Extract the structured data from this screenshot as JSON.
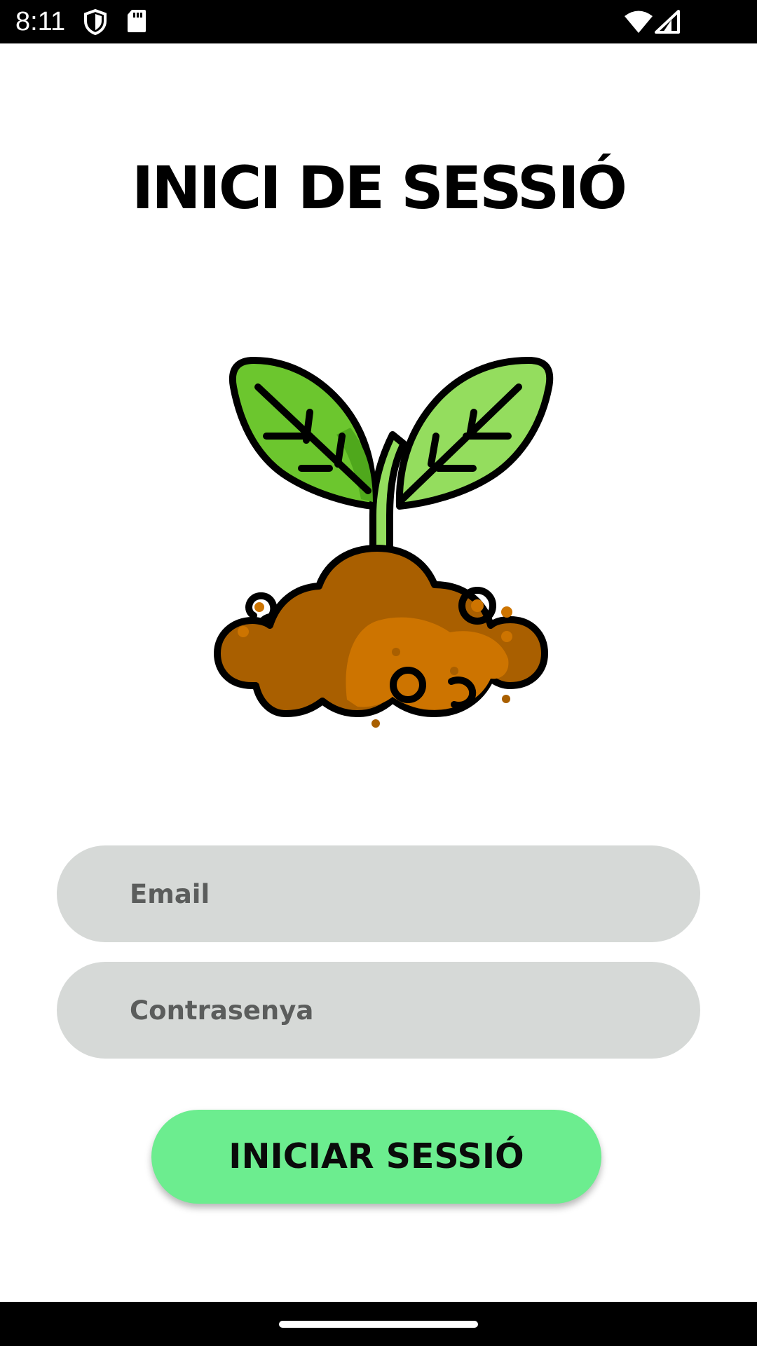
{
  "status_bar": {
    "time": "8:11",
    "left_icons": [
      "shield-icon",
      "sd-card-icon"
    ],
    "right_icons": [
      "wifi-icon",
      "signal-icon"
    ]
  },
  "login": {
    "title": "INICI DE SESSIÓ",
    "illustration": "sprout-in-soil-icon",
    "email": {
      "placeholder": "Email",
      "value": ""
    },
    "password": {
      "placeholder": "Contrasenya",
      "value": ""
    },
    "submit_label": "INICIAR SESSIÓ"
  },
  "colors": {
    "button": "#6ced8f",
    "field_background": "#d6d9d7",
    "leaf_dark": "#6cc62e",
    "leaf_light": "#94dd5e",
    "soil_dark": "#a95f00",
    "soil_light": "#cd7400"
  }
}
